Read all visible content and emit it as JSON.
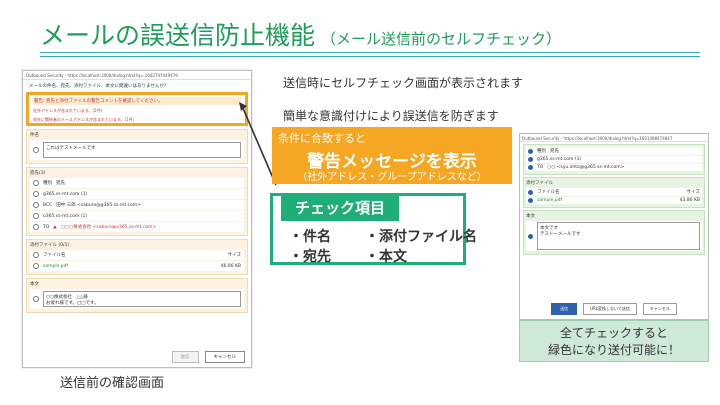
{
  "title": {
    "main": "メールの誤送信防止機能",
    "sub": "（メール送信前のセルフチェック）"
  },
  "left_dialog": {
    "window_title": "Outbound Security - https://localhost:3000/dialog.html?q=-1602747449479",
    "question": "メールの件名、宛先、添付ファイル、本文に間違いはありませんか？",
    "warning_title": "警告: 宛先と添付ファイルの警告コメントを確認してください。",
    "warning_lines": [
      "社外アドレスが含まれています。(2件)",
      "宛先に関係者のメールアドレスが含まれています。(1件)"
    ],
    "subject": {
      "header": "件名",
      "value": "これはテストメールです"
    },
    "recipients": {
      "header": "宛先(3)",
      "col_type": "種別",
      "col_to": "宛先",
      "domain1": "g365.ss-mt.com (1)",
      "bcc_type": "BCC",
      "bcc_value": "田中 三郎 <saburo@g365.ss-mt.com>",
      "domain2": "o365.ss-mt.com (1)",
      "to_type": "TO",
      "to_value": "□□○株式会社 <saburo@o365.ss-mt.com>"
    },
    "attachments": {
      "header": "添付ファイル (0/1)",
      "col_name": "ファイル名",
      "col_size": "サイズ",
      "file": "sample.pdf",
      "size": "46.06 KB"
    },
    "body": {
      "header": "本文",
      "line1": "○○株式会社　△△様",
      "line2": "お疲れ様です。□□です。"
    },
    "send_label": "送信",
    "cancel_label": "キャンセル"
  },
  "caption_left": "送信前の確認画面",
  "bullet1": "送信時にセルフチェック画面が表示されます",
  "bullet2": "簡単な意識付けにより誤送信を防ぎます",
  "callout": {
    "line1": "条件に合致すると",
    "line2": "警告メッセージを表示",
    "line3": "（社外アドレス・グループアドレスなど）"
  },
  "check_items": {
    "heading": "チェック項目",
    "items": [
      "・件名",
      "・添付ファイル名",
      "・宛先",
      "・本文"
    ]
  },
  "right_dialog": {
    "window_title": "Outbound Security - https://localhost:3000/dialog.html?q=1601498474847",
    "col_type": "種別",
    "col_to": "宛先",
    "domain": "g365.ss-mt.com (1)",
    "to_type": "TO",
    "to_value": "○○ <syu.ohta@g365.ss-mt.com>",
    "att_header": "添付ファイル",
    "att_col_name": "ファイル名",
    "att_col_size": "サイズ",
    "att_file": "sample.pdf",
    "att_size": "43.86 KB",
    "body_header": "本文",
    "body_line1": "本文です",
    "body_line2": "テスト一メールです",
    "send_label": "送信",
    "url_label": "URL変換しないで送信",
    "cancel_label": "キャンセル"
  },
  "caption_right": {
    "line1": "全てチェックすると",
    "line2": "緑色になり送付可能に！"
  },
  "colors": {
    "accent_green": "#1e9c5a",
    "warning_orange": "#f5a623",
    "check_green": "#1fae77"
  }
}
